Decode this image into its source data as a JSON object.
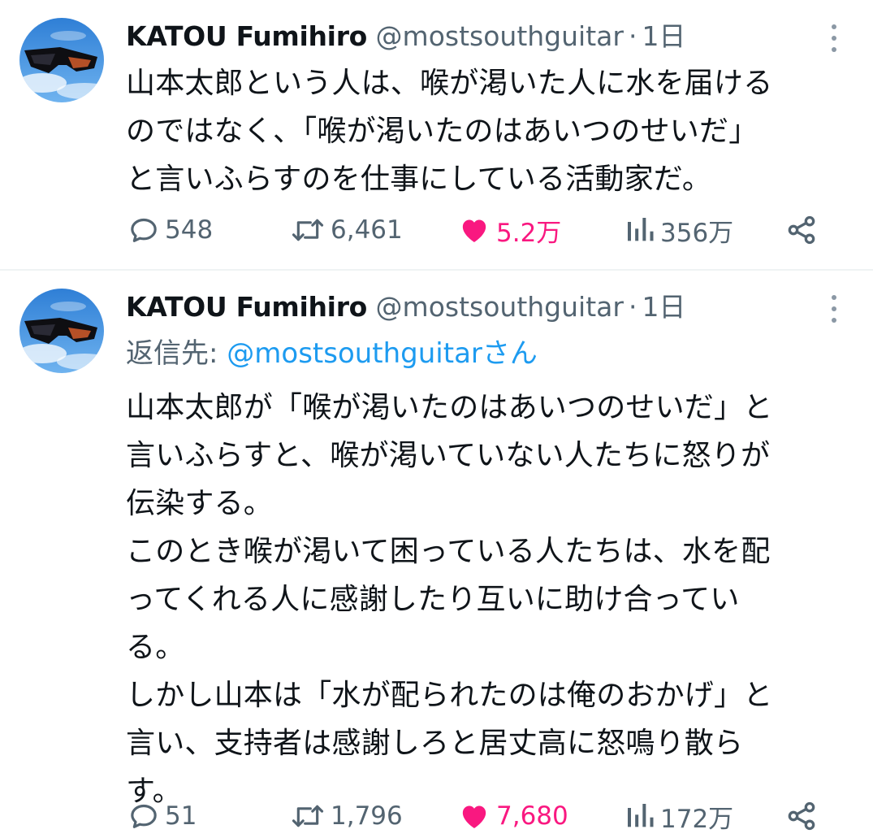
{
  "tweets": [
    {
      "author": {
        "name": "KATOU Fumihiro",
        "handle": "@mostsouthguitar",
        "separator": "·",
        "time": "1日",
        "avatar_icon": "avatar-sunglasses-sky"
      },
      "text": "山本太郎という人は、喉が渇いた人に水を届ける\nのではなく、「喉が渇いたのはあいつのせいだ」\nと言いふらすのを仕事にしている活動家だ。",
      "stats": {
        "replies": "548",
        "retweets": "6,461",
        "likes": "5.2万",
        "views": "356万"
      },
      "liked": true
    },
    {
      "author": {
        "name": "KATOU Fumihiro",
        "handle": "@mostsouthguitar",
        "separator": "·",
        "time": "1日",
        "avatar_icon": "avatar-sunglasses-sky"
      },
      "reply_to": {
        "label": "返信先: ",
        "link": "@mostsouthguitarさん"
      },
      "text": "山本太郎が「喉が渇いたのはあいつのせいだ」と\n言いふらすと、喉が渇いていない人たちに怒りが\n伝染する。\nこのとき喉が渇いて困っている人たちは、水を配\nってくれる人に感謝したり互いに助け合ってい\nる。\nしかし山本は「水が配られたのは俺のおかげ」と\n言い、支持者は感謝しろと居丈高に怒鳴り散ら\nす。",
      "stats": {
        "replies": "51",
        "retweets": "1,796",
        "likes": "7,680",
        "views": "172万"
      },
      "liked": true
    }
  ],
  "colors": {
    "text": "#0f1419",
    "muted": "#536471",
    "link": "#1d9bf0",
    "like": "#f91880",
    "divider": "#eff3f4"
  },
  "icons": [
    "reply-icon",
    "retweet-icon",
    "heart-icon",
    "views-icon",
    "share-icon",
    "more-icon"
  ]
}
